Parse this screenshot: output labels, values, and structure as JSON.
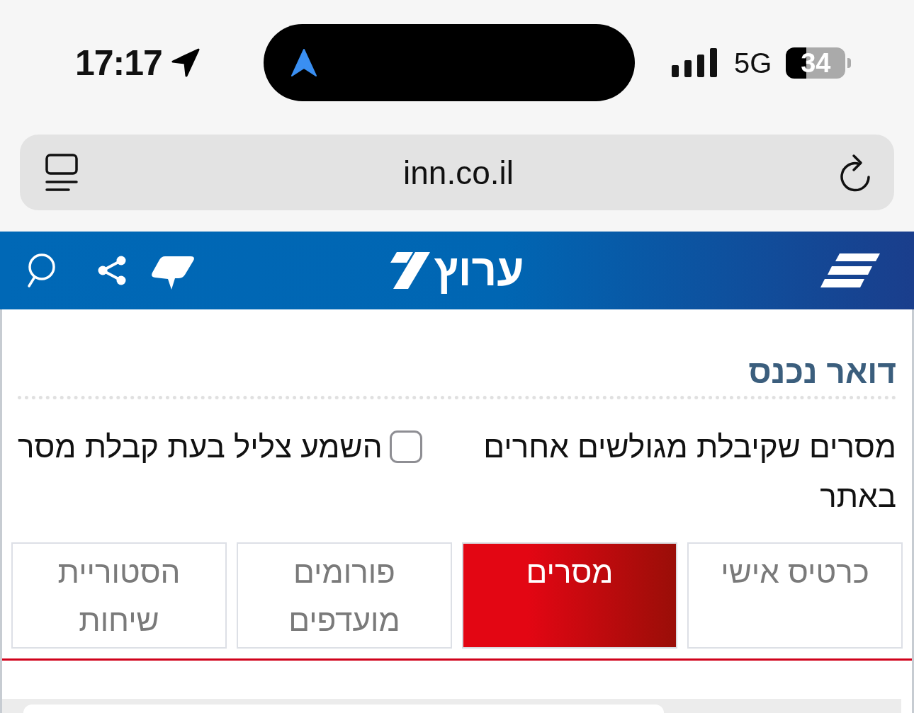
{
  "status_bar": {
    "time": "17:17",
    "network": "5G",
    "battery": "34"
  },
  "address_bar": {
    "url": "inn.co.il"
  },
  "site_header": {
    "logo_text": "ערוץ"
  },
  "inbox": {
    "title": "דואר נכנס",
    "description": "מסרים שקיבלת מגולשים אחרים באתר",
    "sound_option": {
      "label": "השמע צליל בעת קבלת מסר",
      "checked": false
    }
  },
  "tabs": [
    {
      "label": "כרטיס אישי",
      "selected": false
    },
    {
      "label": "מסרים",
      "selected": true
    },
    {
      "label": "פורומים מועדפים",
      "selected": false
    },
    {
      "label": "הסטוריית שיחות",
      "selected": false
    }
  ]
}
